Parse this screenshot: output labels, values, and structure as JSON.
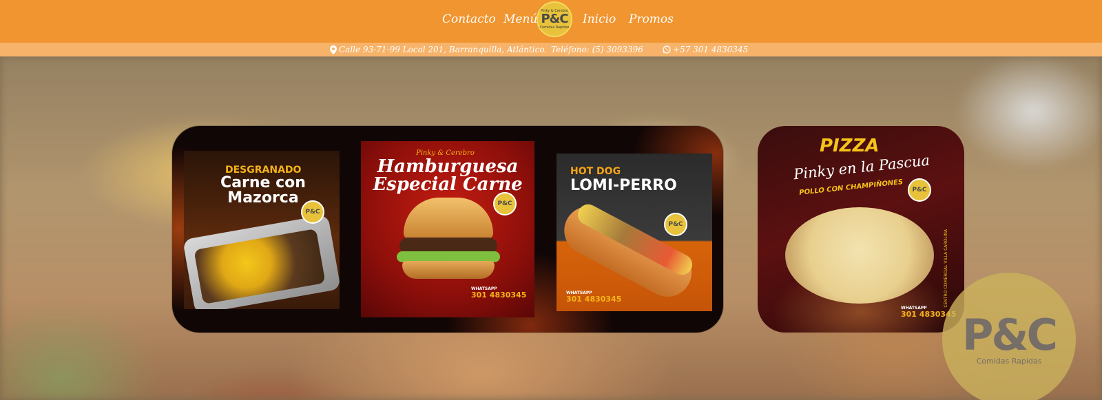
{
  "nav": {
    "items": [
      {
        "label": "Contacto"
      },
      {
        "label": "Menú"
      },
      {
        "label": "Inicio"
      },
      {
        "label": "Promos"
      }
    ]
  },
  "logo": {
    "top": "Pinky & Cerebro",
    "mark": "P&C",
    "sub": "Comidas Rapidas"
  },
  "infobar": {
    "address": "Calle 93-71-99 Local 201, Barranquilla, Atlántico.",
    "phone": "Teléfono: (5) 3093396",
    "whatsapp": "+57 301 4830345",
    "icons": [
      "location-pin-icon",
      "whatsapp-icon"
    ]
  },
  "promos": [
    {
      "kicker": "DESGRANADO",
      "title": "Carne con Mazorca",
      "badge": "P&C"
    },
    {
      "kicker": "Pinky & Cerebro",
      "title": "Hamburguesa Especial Carne",
      "badge": "P&C",
      "whatsapp_label": "WHATSAPP",
      "whatsapp_number": "301 4830345"
    },
    {
      "kicker": "HOT DOG",
      "title": "LOMI-PERRO",
      "badge": "P&C",
      "whatsapp_label": "WHATSAPP",
      "whatsapp_number": "301 4830345"
    }
  ],
  "pizza_card": {
    "title": "PIZZA",
    "subtitle": "Pinky en la Pascua",
    "tag": "POLLO CON CHAMPIÑONES",
    "side": "CENTRO COMERCIAL VILLA CAROLINA",
    "badge": "P&C",
    "whatsapp_label": "WHATSAPP",
    "whatsapp_number": "301 4830345"
  },
  "watermark_logo": {
    "mark": "P&C",
    "sub": "Comidas Rapidas"
  },
  "colors": {
    "header": "#f0952f",
    "infobar": "#f7b36a",
    "accent": "#f6b418"
  }
}
